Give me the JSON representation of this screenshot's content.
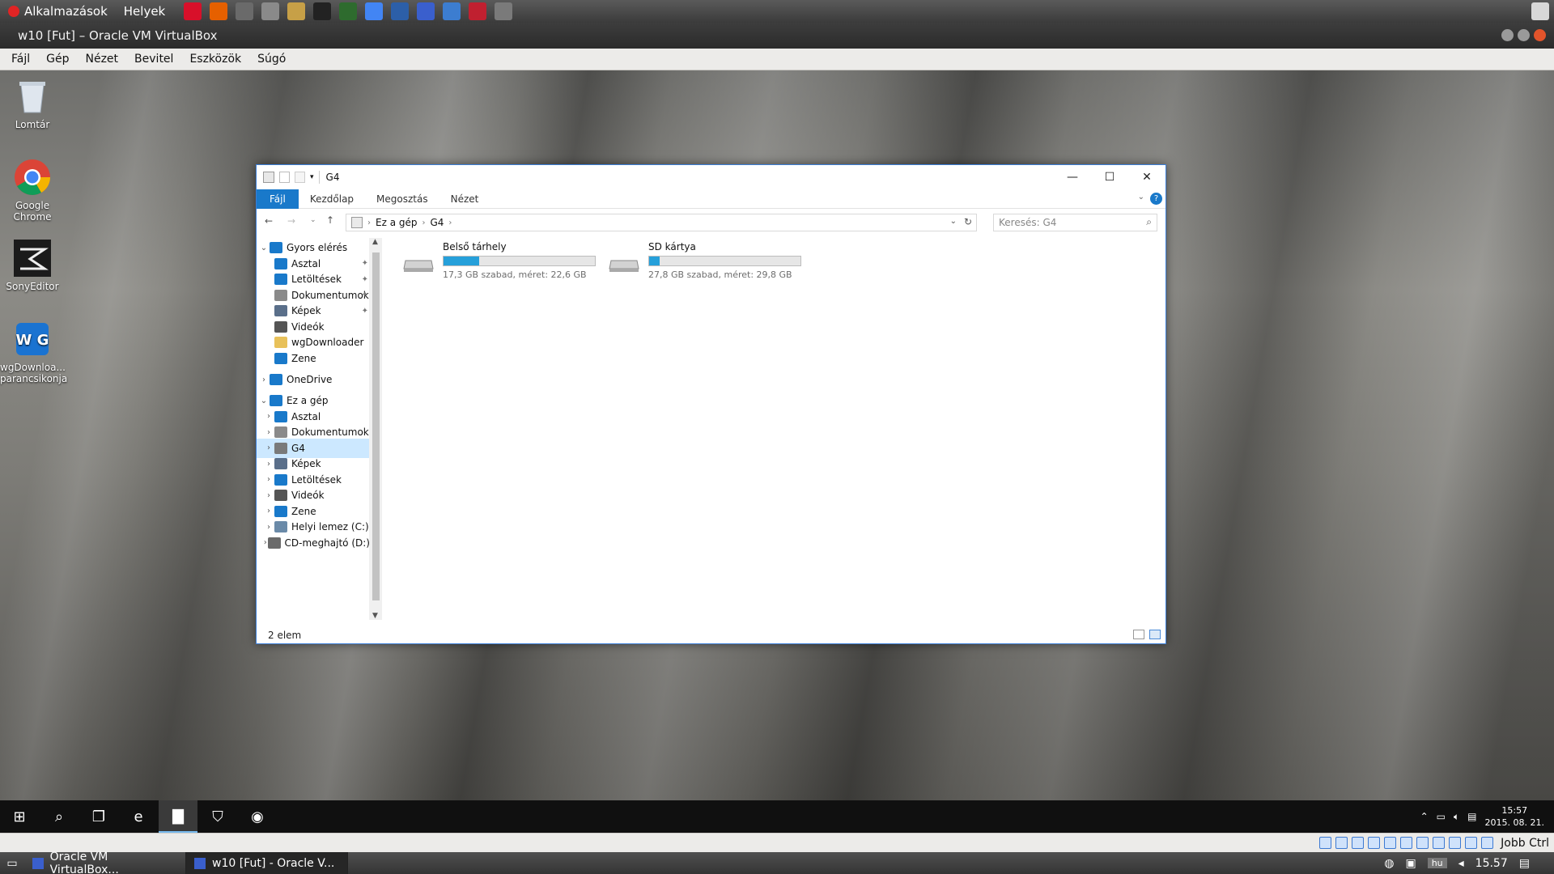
{
  "host_panel": {
    "applications_label": "Alkalmazások",
    "places_label": "Helyek",
    "launchers": [
      {
        "icon": "opera-icon",
        "color": "#d8102a"
      },
      {
        "icon": "firefox-icon",
        "color": "#e66000"
      },
      {
        "icon": "game-icon",
        "color": "#6a6a6a"
      },
      {
        "icon": "printer-icon",
        "color": "#8a8a8a"
      },
      {
        "icon": "text-editor-icon",
        "color": "#c7a047"
      },
      {
        "icon": "terminal-icon",
        "color": "#222222"
      },
      {
        "icon": "system-monitor-icon",
        "color": "#2e6b2e"
      },
      {
        "icon": "chrome-icon",
        "color": "#4285f4"
      },
      {
        "icon": "network-icon",
        "color": "#2c5fa8"
      },
      {
        "icon": "virtualbox-icon",
        "color": "#3a5fcd"
      },
      {
        "icon": "remote-desktop-icon",
        "color": "#3c7dd0"
      },
      {
        "icon": "media-icon",
        "color": "#c02030"
      },
      {
        "icon": "calculator-icon",
        "color": "#7a7a7a"
      }
    ]
  },
  "vbox_window": {
    "title": "w10 [Fut] – Oracle VM VirtualBox",
    "menu": [
      "Fájl",
      "Gép",
      "Nézet",
      "Bevitel",
      "Eszközök",
      "Súgó"
    ]
  },
  "desktop_icons": [
    {
      "label": "Lomtár",
      "icon": "recycle-bin-icon"
    },
    {
      "label": "Google Chrome",
      "icon": "chrome-icon"
    },
    {
      "label": "SonyEditor",
      "icon": "sony-editor-icon"
    },
    {
      "label": "wgDownloa... parancsikonja",
      "icon": "wgdownloader-icon"
    }
  ],
  "explorer": {
    "title": "G4",
    "ribbon_tabs": [
      "Fájl",
      "Kezdőlap",
      "Megosztás",
      "Nézet"
    ],
    "breadcrumb": [
      "Ez a gép",
      "G4"
    ],
    "search_placeholder": "Keresés: G4",
    "nav_items": [
      {
        "label": "Gyors elérés",
        "icon": "star-icon",
        "color": "#1979ca",
        "level": 0,
        "chevron": "down",
        "pinned": false,
        "selected": false
      },
      {
        "label": "Asztal",
        "icon": "desktop-folder-icon",
        "color": "#1979ca",
        "level": 1,
        "chevron": "",
        "pinned": true,
        "selected": false
      },
      {
        "label": "Letöltések",
        "icon": "download-icon",
        "color": "#1979ca",
        "level": 1,
        "chevron": "",
        "pinned": true,
        "selected": false
      },
      {
        "label": "Dokumentumok",
        "icon": "documents-icon",
        "color": "#8a8a8a",
        "level": 1,
        "chevron": "",
        "pinned": true,
        "selected": false
      },
      {
        "label": "Képek",
        "icon": "pictures-icon",
        "color": "#5a6f8a",
        "level": 1,
        "chevron": "",
        "pinned": true,
        "selected": false
      },
      {
        "label": "Videók",
        "icon": "videos-icon",
        "color": "#555555",
        "level": 1,
        "chevron": "",
        "pinned": false,
        "selected": false
      },
      {
        "label": "wgDownloader",
        "icon": "folder-icon",
        "color": "#e8c15a",
        "level": 1,
        "chevron": "",
        "pinned": false,
        "selected": false
      },
      {
        "label": "Zene",
        "icon": "music-icon",
        "color": "#1979ca",
        "level": 1,
        "chevron": "",
        "pinned": false,
        "selected": false
      },
      {
        "label": "OneDrive",
        "icon": "onedrive-icon",
        "color": "#1979ca",
        "level": 0,
        "chevron": "right",
        "pinned": false,
        "selected": false
      },
      {
        "label": "Ez a gép",
        "icon": "this-pc-icon",
        "color": "#1979ca",
        "level": 0,
        "chevron": "down",
        "pinned": false,
        "selected": false
      },
      {
        "label": "Asztal",
        "icon": "desktop-folder-icon",
        "color": "#1979ca",
        "level": 1,
        "chevron": "right",
        "pinned": false,
        "selected": false
      },
      {
        "label": "Dokumentumok",
        "icon": "documents-icon",
        "color": "#8a8a8a",
        "level": 1,
        "chevron": "right",
        "pinned": false,
        "selected": false
      },
      {
        "label": "G4",
        "icon": "phone-device-icon",
        "color": "#7a7a7a",
        "level": 1,
        "chevron": "right",
        "pinned": false,
        "selected": true
      },
      {
        "label": "Képek",
        "icon": "pictures-icon",
        "color": "#5a6f8a",
        "level": 1,
        "chevron": "right",
        "pinned": false,
        "selected": false
      },
      {
        "label": "Letöltések",
        "icon": "download-icon",
        "color": "#1979ca",
        "level": 1,
        "chevron": "right",
        "pinned": false,
        "selected": false
      },
      {
        "label": "Videók",
        "icon": "videos-icon",
        "color": "#555555",
        "level": 1,
        "chevron": "right",
        "pinned": false,
        "selected": false
      },
      {
        "label": "Zene",
        "icon": "music-icon",
        "color": "#1979ca",
        "level": 1,
        "chevron": "right",
        "pinned": false,
        "selected": false
      },
      {
        "label": "Helyi lemez (C:)",
        "icon": "hard-drive-icon",
        "color": "#6a8aa8",
        "level": 1,
        "chevron": "right",
        "pinned": false,
        "selected": false
      },
      {
        "label": "CD-meghajtó (D:)",
        "icon": "cd-drive-icon",
        "color": "#6a6a6a",
        "level": 1,
        "chevron": "right",
        "pinned": false,
        "selected": false
      }
    ],
    "drives": [
      {
        "name": "Belső tárhely",
        "info": "17,3 GB szabad, méret: 22,6 GB",
        "used_fraction": 0.235
      },
      {
        "name": "SD kártya",
        "info": "27,8 GB szabad, méret: 29,8 GB",
        "used_fraction": 0.067
      }
    ],
    "status": "2 elem"
  },
  "win_taskbar": {
    "time": "15:57",
    "date": "2015. 08. 21.",
    "buttons": [
      {
        "icon": "windows-start-icon",
        "glyph": "⊞",
        "active": false
      },
      {
        "icon": "search-icon",
        "glyph": "⌕",
        "active": false
      },
      {
        "icon": "task-view-icon",
        "glyph": "❐",
        "active": false
      },
      {
        "icon": "edge-icon",
        "glyph": "e",
        "active": false
      },
      {
        "icon": "file-explorer-icon",
        "glyph": "▇",
        "active": true
      },
      {
        "icon": "store-icon",
        "glyph": "⛉",
        "active": false
      },
      {
        "icon": "chrome-icon",
        "glyph": "◉",
        "active": false
      }
    ]
  },
  "vbox_status": {
    "host_key": "Jobb Ctrl"
  },
  "host_bottom": {
    "tasks": [
      {
        "label": "Oracle VM VirtualBox...",
        "active": false
      },
      {
        "label": "w10 [Fut] - Oracle V...",
        "active": true
      }
    ],
    "keyboard_layout": "hu",
    "time": "15.57"
  },
  "colors": {
    "accent": "#1979ca",
    "selection": "#cce8ff",
    "drive_bar": "#26a0da"
  }
}
